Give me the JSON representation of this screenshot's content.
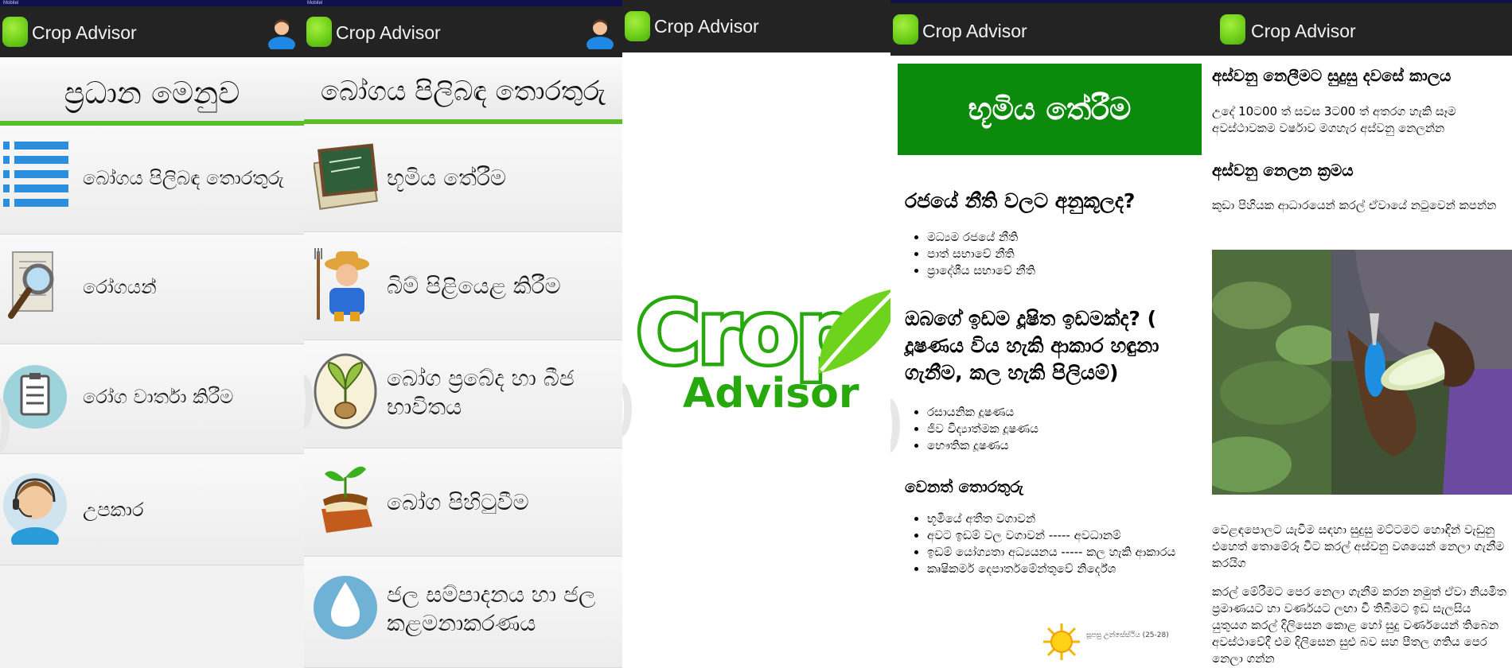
{
  "app": {
    "title": "Crop Advisor",
    "status_text": "Mobitel",
    "colors": {
      "appbar": "#232323",
      "accent_green": "#5cbf2a",
      "banner_green": "#0b8a0b",
      "logo_green": "#27a80c",
      "status_bar": "#10104a"
    }
  },
  "screen_main_menu": {
    "header": "ප්‍රධාන මෙනුව",
    "items": [
      {
        "label": "බෝගය පිලිබඳ තොරතුරු",
        "icon": "list-icon"
      },
      {
        "label": "රෝගයන්",
        "icon": "magnifier-document-icon"
      },
      {
        "label": "රෝග වාර්තා කිරීම",
        "icon": "clipboard-badge-icon"
      },
      {
        "label": "උපකාර",
        "icon": "headset-support-icon"
      }
    ]
  },
  "screen_crop_info": {
    "header": "බෝගය පිලිබඳ තොරතුරු",
    "items": [
      {
        "label": "භූමිය තේරීම",
        "icon": "chalkboard-icon"
      },
      {
        "label": "බිම් පිළියෙළ කිරීම",
        "icon": "farmer-icon"
      },
      {
        "label": "බෝග ප්‍රබේද හා බීජ භාවිතය",
        "icon": "seedling-icon"
      },
      {
        "label": "බෝග පිහිටුවීම",
        "icon": "plant-book-icon"
      },
      {
        "label": "ජල සම්පාදනය හා ජල කළමනාකරණය",
        "icon": "water-drop-icon"
      }
    ]
  },
  "screen_splash": {
    "logo_word_1": "Crop",
    "logo_word_2": "Advisor"
  },
  "screen_land_selection": {
    "banner": "භූමිය තේරීම",
    "sections": [
      {
        "heading": "රජයේ නීති වලට අනුකූලද?",
        "bullets": [
          "මධ්‍යම රජයේ නීති",
          "පාත් සභාවේ නීති",
          "ප්‍රාදේශීය සභාවේ නීති"
        ]
      },
      {
        "heading": "ඔබගේ ඉඩම දූෂිත ඉඩමක්ද? ( දූෂණය විය හැකි ආකාර හඳුනා ගැනීම, කල හැකි පිලියම්)",
        "bullets": [
          "රසායනික දූෂණය",
          "ජීව විද්‍යාත්මක දූෂණය",
          "භෞතික දූෂණය"
        ]
      },
      {
        "heading": "වෙනත් තොරතුරු",
        "bullets": [
          "භූමියේ අතීත වගාවන්",
          "අවට ඉඩම් වල වගාවන් ----- අවධානම්",
          "ඉඩම් යෝග්‍යතා අධ්‍යයනය ----- කල හැකි ආකාරය",
          "කෘෂිකර්ම දෙපාර්තමේන්තුවේ නිර්දේශ"
        ]
      }
    ],
    "footer_caption": "සූපසු උන්සේස්ථිය (25-28)"
  },
  "screen_harvest": {
    "blocks": [
      {
        "type": "heading",
        "text": "අස්වනු නෙලීමට සුදුසු දවසේ කාලය"
      },
      {
        "type": "para",
        "text": "උදේ 10ට00 ත් සවස 3ට00 ත් අතරග හැකි සෑම අවස්ථාවකම වර්ෂාව මගහැර අස්වනු නෙලන්න"
      },
      {
        "type": "heading",
        "text": "අස්වනු නෙලන ක්‍රමය"
      },
      {
        "type": "para",
        "text": "කුඩා පිහියක ආධාරයෙන් කරල් ඒවායේ නටුවෙන් කපන්න"
      },
      {
        "type": "para",
        "text": "වෙළඳපොලට යැවීම සඳහා සුදුසු මට්ටමට හොඳින් වැඩුනු එහෙත් තොමේරූ විට කරල් අස්වනු වශයෙන් නෙලා ගැනීම කරයිග"
      },
      {
        "type": "para",
        "text": "කරල් මේරීමට පෙර නෙලා ගැනීම කරන නමුත් ඒවා නියමිත ප්‍රමාණයට හා වර්ණයට ලඟා වී තිබීමට ඉඩ සැලසිය යුතුයග කරල් දිලිසෙන කොළ හෝ සුදු වර්ණයෙන් තිබෙන අවස්ථාවේදී එම දිලිසෙන සුළු බව සහ පීතල ගතිය පෙර නෙලා ගන්න"
      }
    ],
    "photo_alt": "hand-cutting-pod-photo"
  }
}
